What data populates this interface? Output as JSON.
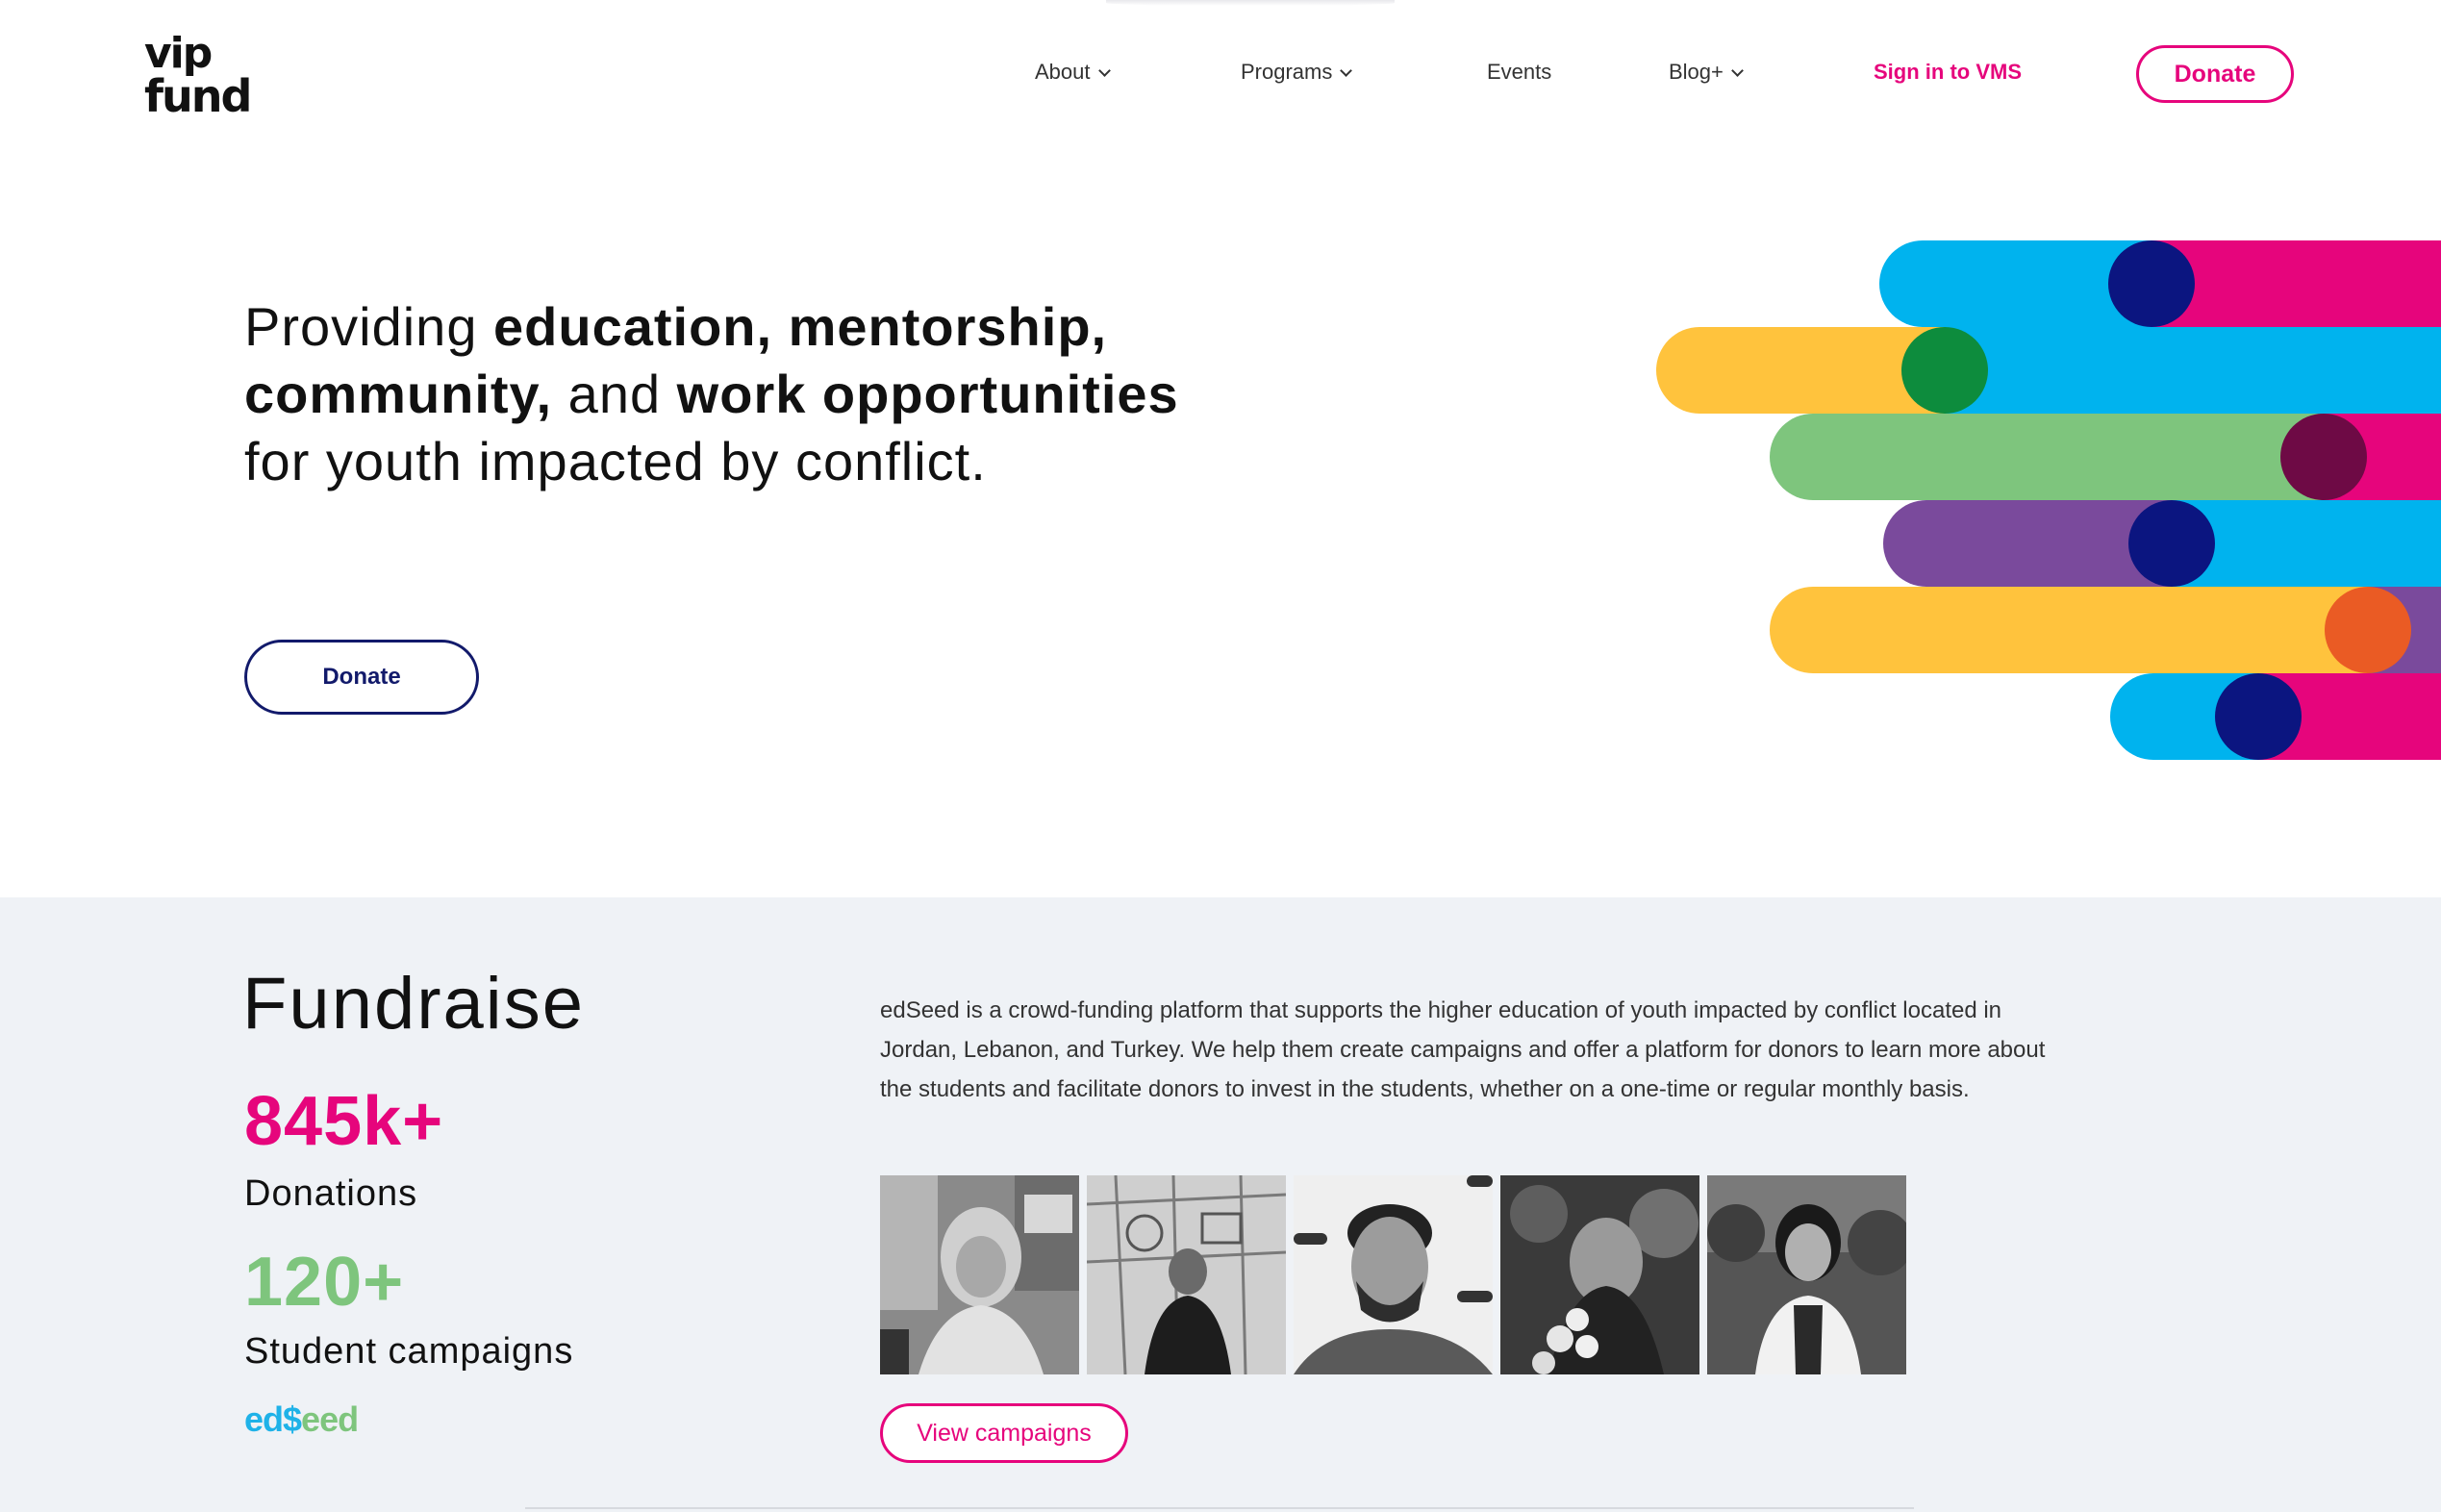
{
  "brand": {
    "logo_line1": "vip",
    "logo_line2": "fund"
  },
  "nav": {
    "about": "About",
    "programs": "Programs",
    "events": "Events",
    "blog": "Blog+",
    "signin": "Sign in to VMS",
    "donate": "Donate"
  },
  "hero": {
    "t1": "Providing ",
    "b1": "education, mentorship, community,",
    "t2": " and ",
    "b2": "work opportunities",
    "t3": " for youth impacted by conflict.",
    "donate": "Donate"
  },
  "fundraise": {
    "title": "Fundraise",
    "stat1_value": "845k+",
    "stat1_label": "Donations",
    "stat2_value": "120+",
    "stat2_label": "Student campaigns",
    "logo_a": "ed",
    "logo_b": "$",
    "logo_c": "eed",
    "description": "edSeed is a crowd-funding platform that supports the higher education of youth impacted by conflict located in Jordan, Lebanon, and Turkey. We help them create campaigns and offer a platform for donors to learn more about the students and facilitate donors to invest in the students, whether on a one-time or regular monthly basis.",
    "cta": "View campaigns"
  },
  "colors": {
    "brand_pink": "#e6057c",
    "navy": "#121a6b",
    "green": "#7ec57d",
    "section_bg": "#eff2f6"
  }
}
